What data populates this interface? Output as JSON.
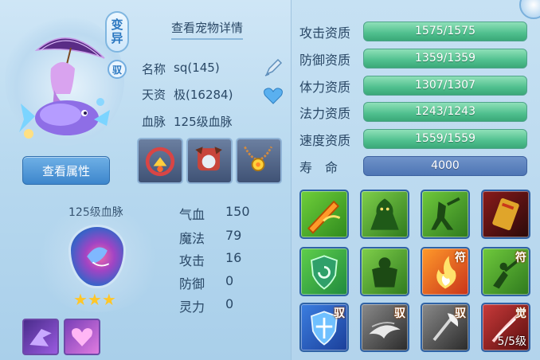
{
  "pet": {
    "badge_bianyi": "变\n异",
    "badge_bianyi_top": "变",
    "badge_bianyi_bottom": "异",
    "badge_yu": "驭",
    "view_attrs_button": "查看属性"
  },
  "details": {
    "title": "查看宠物详情",
    "name_label": "名称",
    "name_value": "sq(145)",
    "talent_label": "天资",
    "talent_value": "极(16284)",
    "bloodline_label": "血脉",
    "bloodline_value": "125级血脉"
  },
  "bloodline": {
    "title": "125级血脉",
    "stars": "★★★",
    "star_count": 3
  },
  "stats": [
    {
      "label": "气血",
      "value": "150"
    },
    {
      "label": "魔法",
      "value": "79"
    },
    {
      "label": "攻击",
      "value": "16"
    },
    {
      "label": "防御",
      "value": "0"
    },
    {
      "label": "灵力",
      "value": "0"
    }
  ],
  "qualities": [
    {
      "label": "攻击资质",
      "value": "1575/1575",
      "fill": 1.0
    },
    {
      "label": "防御资质",
      "value": "1359/1359",
      "fill": 1.0
    },
    {
      "label": "体力资质",
      "value": "1307/1307",
      "fill": 1.0
    },
    {
      "label": "法力资质",
      "value": "1243/1243",
      "fill": 1.0
    },
    {
      "label": "速度资质",
      "value": "1559/1559",
      "fill": 1.0
    }
  ],
  "lifespan": {
    "label": "寿　命",
    "value": "4000"
  },
  "skills": [
    {
      "name": "fire-sword-skill",
      "tag": "",
      "level": ""
    },
    {
      "name": "green-demon-skill",
      "tag": "",
      "level": ""
    },
    {
      "name": "shadow-warrior-skill",
      "tag": "",
      "level": ""
    },
    {
      "name": "golden-tome-skill",
      "tag": "",
      "level": ""
    },
    {
      "name": "shield-recovery-skill",
      "tag": "",
      "level": ""
    },
    {
      "name": "green-brute-skill",
      "tag": "",
      "level": ""
    },
    {
      "name": "flame-rune-skill",
      "tag": "符",
      "level": ""
    },
    {
      "name": "shadow-blade-rune-skill",
      "tag": "符",
      "level": ""
    },
    {
      "name": "ice-shield-skill",
      "tag": "驭",
      "level": ""
    },
    {
      "name": "whirlwind-skill",
      "tag": "驭",
      "level": ""
    },
    {
      "name": "axe-strike-skill",
      "tag": "驭",
      "level": ""
    },
    {
      "name": "awaken-slash-skill",
      "tag": "觉",
      "level": "5/5级"
    }
  ],
  "colors": {
    "quality_bar": "#4fbf8e",
    "life_bar": "#4e75b4",
    "star": "#ffc629",
    "button": "#3d86cc"
  }
}
